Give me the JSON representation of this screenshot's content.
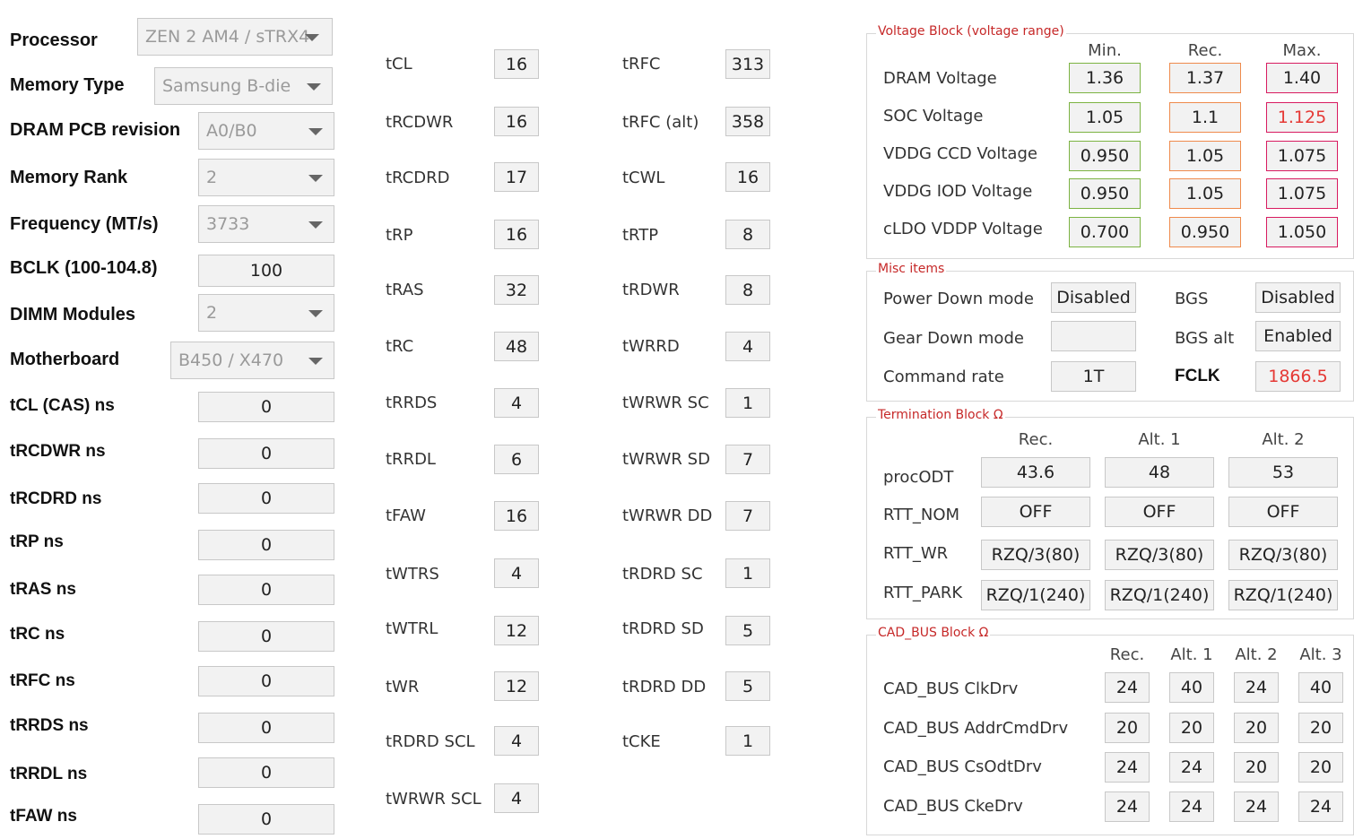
{
  "config": {
    "processor_label": "Processor",
    "processor_value": "ZEN 2 AM4 / sTRX4",
    "memtype_label": "Memory Type",
    "memtype_value": "Samsung B-die",
    "pcb_label": "DRAM PCB revision",
    "pcb_value": "A0/B0",
    "rank_label": "Memory Rank",
    "rank_value": "2",
    "freq_label": "Frequency (MT/s)",
    "freq_value": "3733",
    "bclk_label": "BCLK (100-104.8)",
    "bclk_value": "100",
    "dimm_label": "DIMM Modules",
    "dimm_value": "2",
    "mb_label": "Motherboard",
    "mb_value": "B450 / X470"
  },
  "ns_rows": [
    {
      "label": "tCL (CAS) ns",
      "value": "0"
    },
    {
      "label": "tRCDWR ns",
      "value": "0"
    },
    {
      "label": "tRCDRD ns",
      "value": "0"
    },
    {
      "label": "tRP ns",
      "value": "0"
    },
    {
      "label": "tRAS ns",
      "value": "0"
    },
    {
      "label": "tRC ns",
      "value": "0"
    },
    {
      "label": "tRFC ns",
      "value": "0"
    },
    {
      "label": "tRRDS ns",
      "value": "0"
    },
    {
      "label": "tRRDL ns",
      "value": "0"
    },
    {
      "label": "tFAW ns",
      "value": "0"
    }
  ],
  "timings_left": [
    {
      "label": "tCL",
      "value": "16"
    },
    {
      "label": "tRCDWR",
      "value": "16"
    },
    {
      "label": "tRCDRD",
      "value": "17"
    },
    {
      "label": "tRP",
      "value": "16"
    },
    {
      "label": "tRAS",
      "value": "32"
    },
    {
      "label": "tRC",
      "value": "48"
    },
    {
      "label": "tRRDS",
      "value": "4"
    },
    {
      "label": "tRRDL",
      "value": "6"
    },
    {
      "label": "tFAW",
      "value": "16"
    },
    {
      "label": "tWTRS",
      "value": "4"
    },
    {
      "label": "tWTRL",
      "value": "12"
    },
    {
      "label": "tWR",
      "value": "12"
    },
    {
      "label": "tRDRD SCL",
      "value": "4"
    },
    {
      "label": "tWRWR SCL",
      "value": "4"
    }
  ],
  "timings_right": [
    {
      "label": "tRFC",
      "value": "313"
    },
    {
      "label": "tRFC (alt)",
      "value": "358"
    },
    {
      "label": "tCWL",
      "value": "16"
    },
    {
      "label": "tRTP",
      "value": "8"
    },
    {
      "label": "tRDWR",
      "value": "8"
    },
    {
      "label": "tWRRD",
      "value": "4"
    },
    {
      "label": "tWRWR SC",
      "value": "1"
    },
    {
      "label": "tWRWR SD",
      "value": "7"
    },
    {
      "label": "tWRWR DD",
      "value": "7"
    },
    {
      "label": "tRDRD SC",
      "value": "1"
    },
    {
      "label": "tRDRD SD",
      "value": "5"
    },
    {
      "label": "tRDRD DD",
      "value": "5"
    },
    {
      "label": "tCKE",
      "value": "1"
    }
  ],
  "voltage": {
    "title": "Voltage Block (voltage range)",
    "headers": [
      "Min.",
      "Rec.",
      "Max."
    ],
    "rows": [
      {
        "label": "DRAM Voltage",
        "min": "1.36",
        "rec": "1.37",
        "max": "1.40"
      },
      {
        "label": "SOC Voltage",
        "min": "1.05",
        "rec": "1.1",
        "max": "1.125"
      },
      {
        "label": "VDDG  CCD Voltage",
        "min": "0.950",
        "rec": "1.05",
        "max": "1.075"
      },
      {
        "label": "VDDG  IOD Voltage",
        "min": "0.950",
        "rec": "1.05",
        "max": "1.075"
      },
      {
        "label": "cLDO VDDP Voltage",
        "min": "0.700",
        "rec": "0.950",
        "max": "1.050"
      }
    ],
    "colors": {
      "min": "#7cb342",
      "rec": "#ef8a4c",
      "max": "#d81b60"
    }
  },
  "misc": {
    "title": "Misc items",
    "powerdown_label": "Power Down mode",
    "powerdown_value": "Disabled",
    "geardown_label": "Gear Down mode",
    "geardown_value": "",
    "cmdrate_label": "Command rate",
    "cmdrate_value": "1T",
    "bgs_label": "BGS",
    "bgs_value": "Disabled",
    "bgsalt_label": "BGS alt",
    "bgsalt_value": "Enabled",
    "fclk_label": "FCLK",
    "fclk_value": "1866.5"
  },
  "termination": {
    "title": "Termination Block Ω",
    "headers": [
      "Rec.",
      "Alt. 1",
      "Alt. 2"
    ],
    "rows": [
      {
        "label": "procODT",
        "values": [
          "43.6",
          "48",
          "53"
        ]
      },
      {
        "label": "RTT_NOM",
        "values": [
          "OFF",
          "OFF",
          "OFF"
        ]
      },
      {
        "label": "RTT_WR",
        "values": [
          "RZQ/3(80)",
          "RZQ/3(80)",
          "RZQ/3(80)"
        ]
      },
      {
        "label": "RTT_PARK",
        "values": [
          "RZQ/1(240)",
          "RZQ/1(240)",
          "RZQ/1(240)"
        ]
      }
    ]
  },
  "cadbus": {
    "title": "CAD_BUS Block Ω",
    "headers": [
      "Rec.",
      "Alt. 1",
      "Alt. 2",
      "Alt. 3"
    ],
    "rows": [
      {
        "label": "CAD_BUS ClkDrv",
        "values": [
          "24",
          "40",
          "24",
          "40"
        ]
      },
      {
        "label": "CAD_BUS AddrCmdDrv",
        "values": [
          "20",
          "20",
          "20",
          "20"
        ]
      },
      {
        "label": "CAD_BUS CsOdtDrv",
        "values": [
          "24",
          "24",
          "20",
          "20"
        ]
      },
      {
        "label": "CAD_BUS CkeDrv",
        "values": [
          "24",
          "24",
          "24",
          "24"
        ]
      }
    ]
  }
}
